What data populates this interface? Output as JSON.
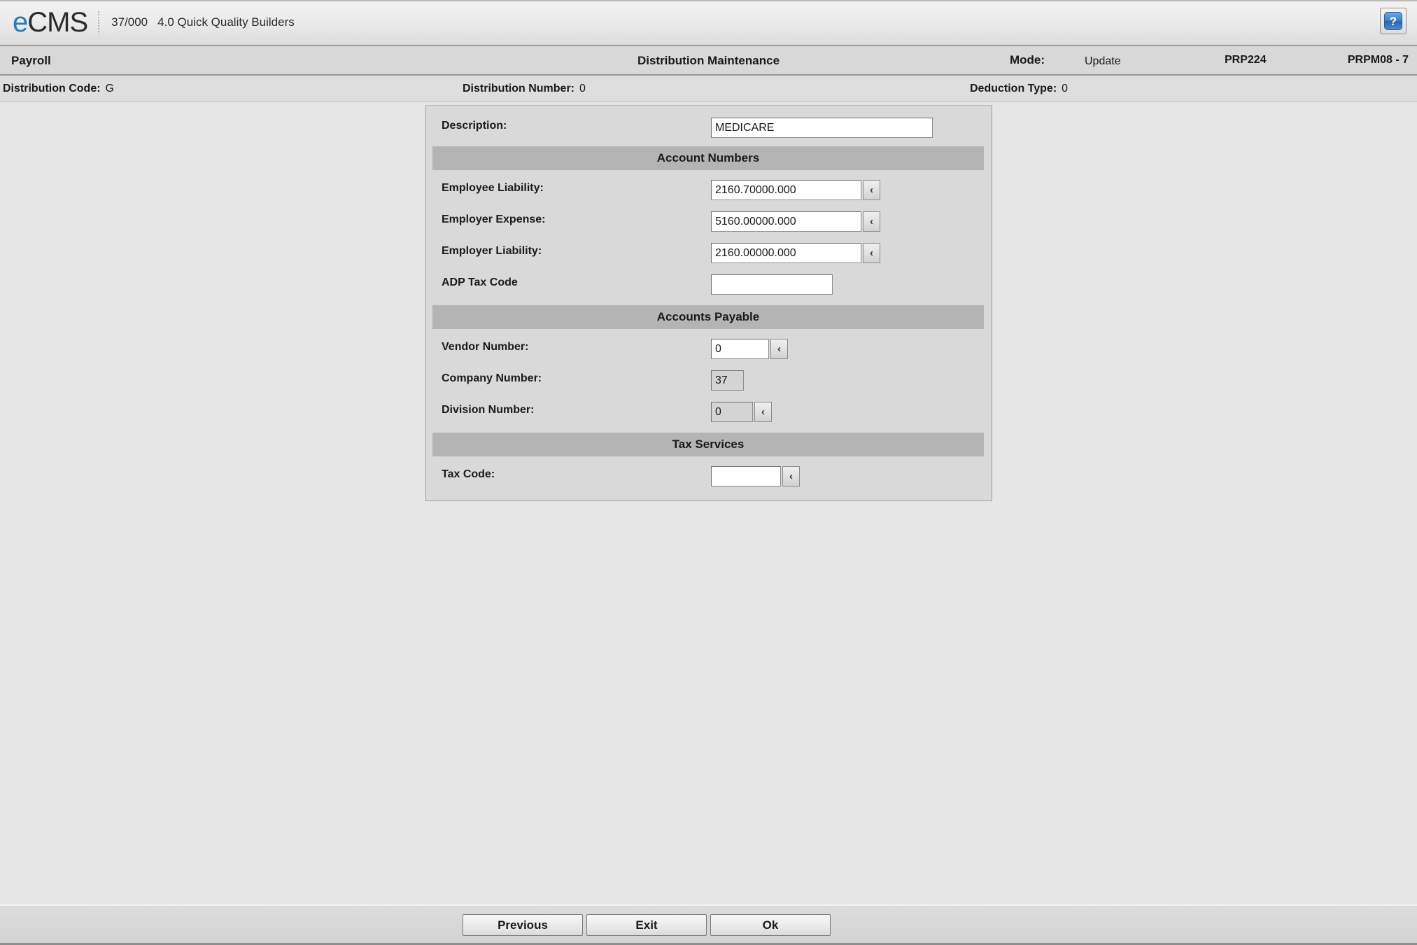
{
  "brand": {
    "logo_e": "e",
    "logo_cms": "CMS",
    "company_code": "37/000",
    "company_name": "4.0 Quick Quality Builders",
    "help_glyph": "?",
    "accent_blue": "#2a7ab0"
  },
  "titlebar": {
    "module": "Payroll",
    "screen_title": "Distribution Maintenance",
    "mode_label": "Mode:",
    "mode_value": "Update",
    "program_id": "PRP224",
    "screen_id": "PRPM08 - 7"
  },
  "keybar": {
    "distribution_code_label": "Distribution Code:",
    "distribution_code_value": "G",
    "distribution_number_label": "Distribution Number:",
    "distribution_number_value": "0",
    "deduction_type_label": "Deduction Type:",
    "deduction_type_value": "0"
  },
  "form": {
    "description_label": "Description:",
    "description_value": "MEDICARE",
    "sections": {
      "account_numbers": "Account Numbers",
      "accounts_payable": "Accounts Payable",
      "tax_services": "Tax Services"
    },
    "employee_liability_label": "Employee Liability:",
    "employee_liability_value": "2160.70000.000",
    "employer_expense_label": "Employer Expense:",
    "employer_expense_value": "5160.00000.000",
    "employer_liability_label": "Employer Liability:",
    "employer_liability_value": "2160.00000.000",
    "adp_tax_code_label": "ADP Tax Code",
    "adp_tax_code_value": "",
    "vendor_number_label": "Vendor Number:",
    "vendor_number_value": "0",
    "company_number_label": "Company Number:",
    "company_number_value": "37",
    "division_number_label": "Division Number:",
    "division_number_value": "0",
    "tax_code_label": "Tax Code:",
    "tax_code_value": "",
    "lookup_glyph": "‹"
  },
  "footer": {
    "previous_label": "Previous",
    "exit_label": "Exit",
    "ok_label": "Ok"
  }
}
